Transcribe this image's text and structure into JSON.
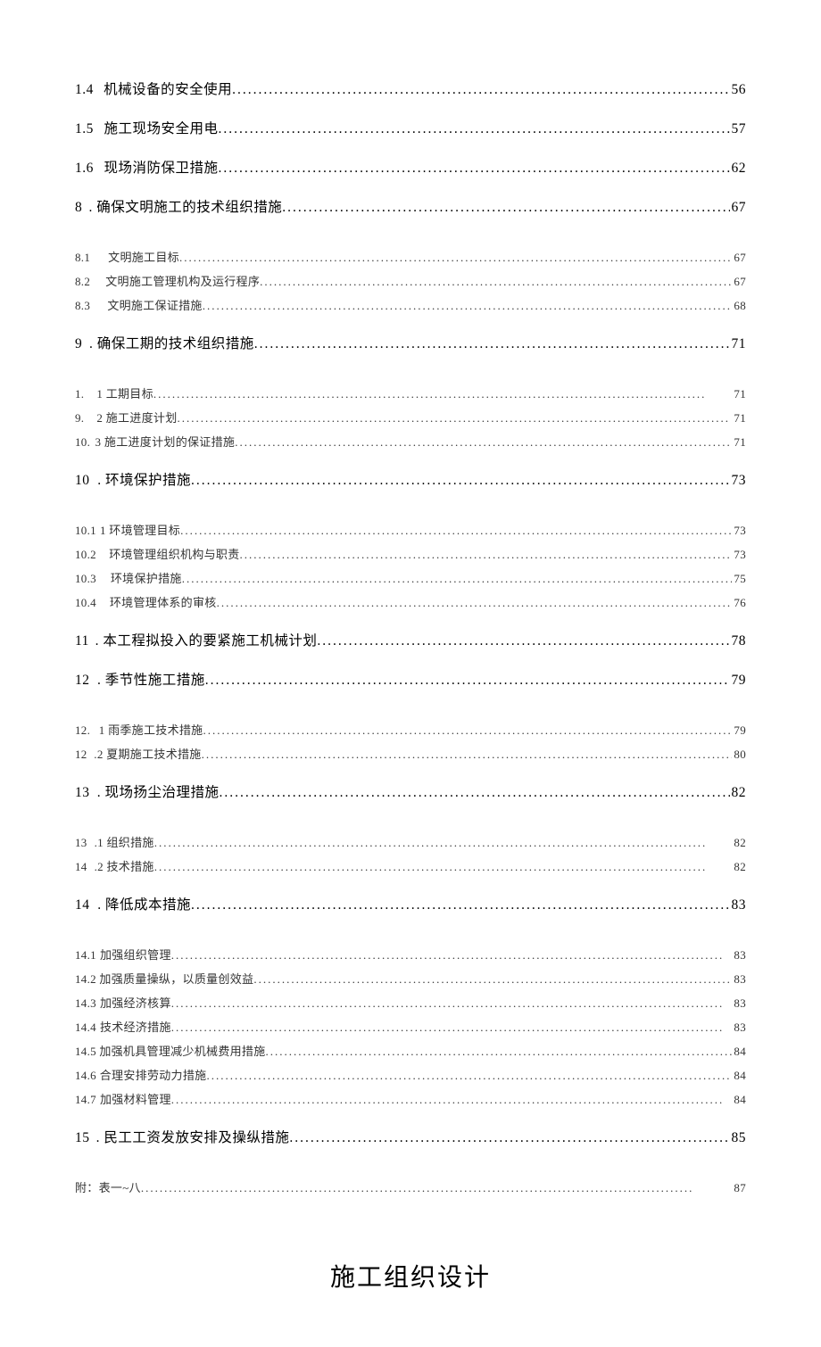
{
  "toc": [
    {
      "level": 1,
      "num": "1.4",
      "title": "机械设备的安全使用",
      "page": "56",
      "gap_num_title": 14
    },
    {
      "level": 1,
      "num": "1.5",
      "title": "施工现场安全用电",
      "page": "57",
      "gap_num_title": 14
    },
    {
      "level": 1,
      "num": "1.6",
      "title": "现场消防保卫措施 ",
      "page": "62",
      "gap_num_title": 14
    },
    {
      "level": 1,
      "num": "8",
      "title": ". 确保文明施工的技术组织措施",
      "page": "67",
      "gap_num_title": 10
    },
    {
      "group_gap": true
    },
    {
      "level": 2,
      "num": "8.1",
      "title": "文明施工目标 ",
      "page": "67",
      "gap_num_title": 20
    },
    {
      "level": 2,
      "num": "8.2",
      "title": "文明施工管理机构及运行程序 ",
      "page": "67",
      "gap_num_title": 20
    },
    {
      "level": 2,
      "num": "8.3",
      "title": "文明施工保证措施 ",
      "page": "68",
      "gap_num_title": 20
    },
    {
      "group_gap": true
    },
    {
      "level": 1,
      "num": "9",
      "title": ". 确保工期的技术组织措施",
      "page": "71",
      "gap_num_title": 10
    },
    {
      "group_gap": true
    },
    {
      "level": 2,
      "num": "1.",
      "title": "1 工期目标 ",
      "page": "71",
      "gap_num_title": 14
    },
    {
      "level": 2,
      "num": "9.",
      "title": "2 施工进度计划 ",
      "page": "71",
      "gap_num_title": 14
    },
    {
      "level": 2,
      "num": "10.",
      "title": "3 施工进度计划的保证措施 ",
      "page": "71",
      "gap_num_title": 6
    },
    {
      "group_gap": true
    },
    {
      "level": 1,
      "num": "10",
      "title": ". 环境保护措施",
      "page": "73",
      "gap_num_title": 10
    },
    {
      "group_gap": true
    },
    {
      "level": 2,
      "num": "10.1",
      "title": "1 环境管理目标",
      "page": "73",
      "gap_num_title": 4
    },
    {
      "level": 2,
      "num": "10.2",
      "title": "环境管理组织机构与职责 ",
      "page": "73",
      "gap_num_title": 16
    },
    {
      "level": 2,
      "num": "10.3",
      "title": "环境保护措施 ",
      "page": "75",
      "gap_num_title": 16
    },
    {
      "level": 2,
      "num": "10.4",
      "title": "环境管理体系的审核 ",
      "page": "76",
      "gap_num_title": 16
    },
    {
      "group_gap": true
    },
    {
      "level": 1,
      "num": "11",
      "title": ". 本工程拟投入的要紧施工机械计划",
      "page": "78",
      "gap_num_title": 10
    },
    {
      "level": 1,
      "num": "12",
      "title": ". 季节性施工措施",
      "page": "79",
      "gap_num_title": 10
    },
    {
      "group_gap": true
    },
    {
      "level": 2,
      "num": "12.",
      "title": "1 雨季施工技术措施",
      "page": "79",
      "gap_num_title": 10
    },
    {
      "level": 2,
      "num": "12",
      "title": ".2 夏期施工技术措施",
      "page": "80",
      "gap_num_title": 8
    },
    {
      "group_gap": true
    },
    {
      "level": 1,
      "num": "13",
      "title": ". 现场扬尘治理措施",
      "page": "82",
      "gap_num_title": 10
    },
    {
      "group_gap": true
    },
    {
      "level": 2,
      "num": "13",
      "title": ".1 组织措施",
      "page": "82",
      "gap_num_title": 8
    },
    {
      "level": 2,
      "num": "14",
      "title": ".2 技术措施",
      "page": "82",
      "gap_num_title": 8
    },
    {
      "group_gap": true
    },
    {
      "level": 1,
      "num": "14",
      "title": ". 降低成本措施",
      "page": "83",
      "gap_num_title": 10
    },
    {
      "group_gap": true
    },
    {
      "level": 2,
      "num": "14.1",
      "title": "加强组织管理 ",
      "page": "83",
      "gap_num_title": 4
    },
    {
      "level": 2,
      "num": "14.2",
      "title": "加强质量操纵，以质量创效益 ",
      "page": "83",
      "gap_num_title": 4
    },
    {
      "level": 2,
      "num": "14.3",
      "title": "加强经济核算 ",
      "page": "83",
      "gap_num_title": 4
    },
    {
      "level": 2,
      "num": "14.4",
      "title": "技术经济措施 ",
      "page": "83",
      "gap_num_title": 4
    },
    {
      "level": 2,
      "num": "14.5",
      "title": "加强机具管理减少机械费用措施 ",
      "page": "84",
      "gap_num_title": 4
    },
    {
      "level": 2,
      "num": "14.6",
      "title": "合理安排劳动力措施 ",
      "page": "84",
      "gap_num_title": 4
    },
    {
      "level": 2,
      "num": "14.7",
      "title": "加强材料管理 ",
      "page": "84",
      "gap_num_title": 4
    },
    {
      "group_gap": true
    },
    {
      "level": 1,
      "num": "15",
      "title": ". 民工工资发放安排及操纵措施",
      "page": "85",
      "gap_num_title": 10
    },
    {
      "group_gap": true
    },
    {
      "level": 2,
      "num": "",
      "title": "附：表一~八 ",
      "page": "87",
      "gap_num_title": 0
    }
  ],
  "main_title": "施工组织设计"
}
